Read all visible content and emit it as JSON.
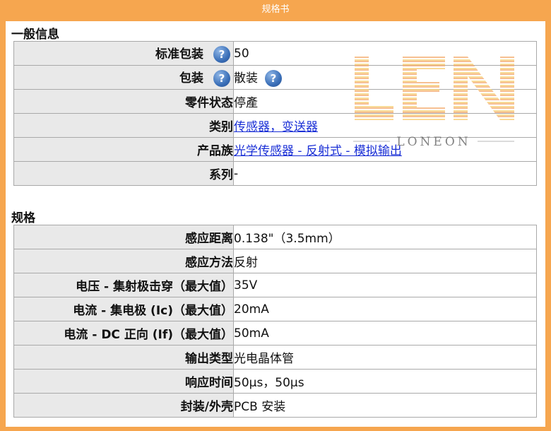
{
  "window": {
    "title": "规格书"
  },
  "general": {
    "heading": "一般信息",
    "rows": [
      {
        "label": "标准包装",
        "value": "50"
      },
      {
        "label": "包装",
        "value": "散装"
      },
      {
        "label": "零件状态",
        "value": "停產"
      },
      {
        "label": "类别",
        "value": "传感器，变送器"
      },
      {
        "label": "产品族",
        "value": "光学传感器 - 反射式 - 模拟输出"
      },
      {
        "label": "系列",
        "value": "-"
      }
    ]
  },
  "specs": {
    "heading": "规格",
    "rows": [
      {
        "label": "感应距离",
        "value": "0.138\"（3.5mm）"
      },
      {
        "label": "感应方法",
        "value": "反射"
      },
      {
        "label": "电压 - 集射极击穿（最大值）",
        "value": "35V"
      },
      {
        "label": "电流 - 集电极 (Ic)（最大值）",
        "value": "20mA"
      },
      {
        "label": "电流 - DC 正向 (If)（最大值）",
        "value": "50mA"
      },
      {
        "label": "输出类型",
        "value": "光电晶体管"
      },
      {
        "label": "响应时间",
        "value": "50µs，50µs"
      },
      {
        "label": "封装/外壳",
        "value": "PCB 安装"
      }
    ]
  },
  "help_icon": {
    "glyph": "?",
    "icon": "question-help-icon"
  },
  "watermark": {
    "logo_text": "LEN",
    "sub_text": "LONEON"
  },
  "colors": {
    "frame": "#f6a64f",
    "label_bg": "#e9e9e9",
    "link": "#1a2fd6"
  }
}
